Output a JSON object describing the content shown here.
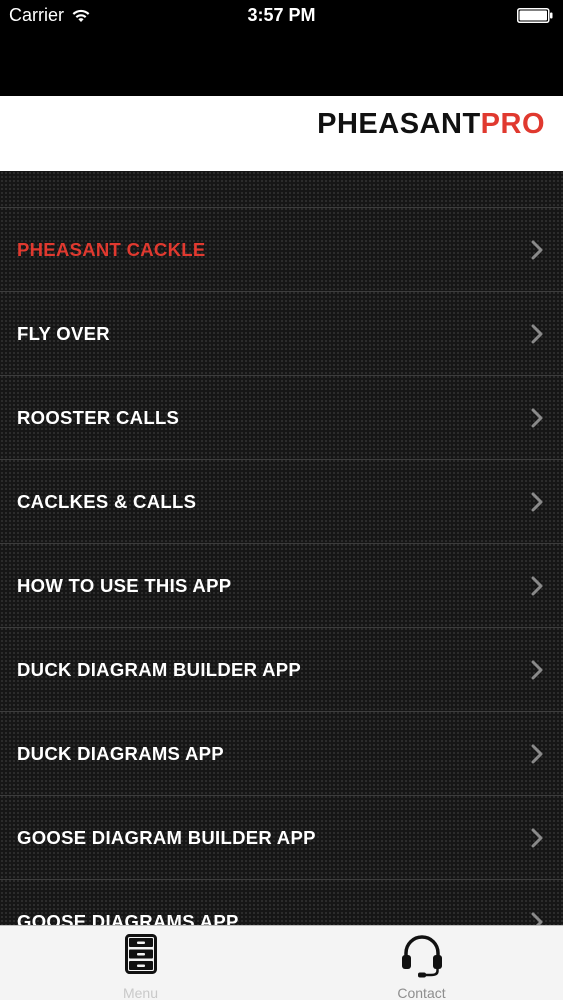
{
  "status_bar": {
    "carrier": "Carrier",
    "time": "3:57 PM",
    "wifi_icon": "wifi-icon",
    "battery_icon": "battery-icon"
  },
  "header": {
    "logo_part1": "PHEASANT",
    "logo_part2": "PRO",
    "logo_colors": {
      "part1": "#111111",
      "part2": "#e0392f"
    }
  },
  "menu": {
    "items": [
      {
        "label": "PHEASANT CACKLE",
        "active": true
      },
      {
        "label": "FLY OVER"
      },
      {
        "label": "ROOSTER CALLS"
      },
      {
        "label": "CACLKES & CALLS"
      },
      {
        "label": "HOW TO USE THIS APP"
      },
      {
        "label": "DUCK DIAGRAM BUILDER APP"
      },
      {
        "label": "DUCK DIAGRAMS APP"
      },
      {
        "label": "GOOSE DIAGRAM BUILDER APP"
      },
      {
        "label": "GOOSE DIAGRAMS APP"
      }
    ],
    "chevron_icon": "chevron-right-icon",
    "active_color": "#e0392f"
  },
  "tab_bar": {
    "tabs": [
      {
        "label": "Menu",
        "icon": "file-cabinet-icon",
        "selected": true
      },
      {
        "label": "Contact",
        "icon": "headset-icon",
        "selected": false
      }
    ]
  }
}
